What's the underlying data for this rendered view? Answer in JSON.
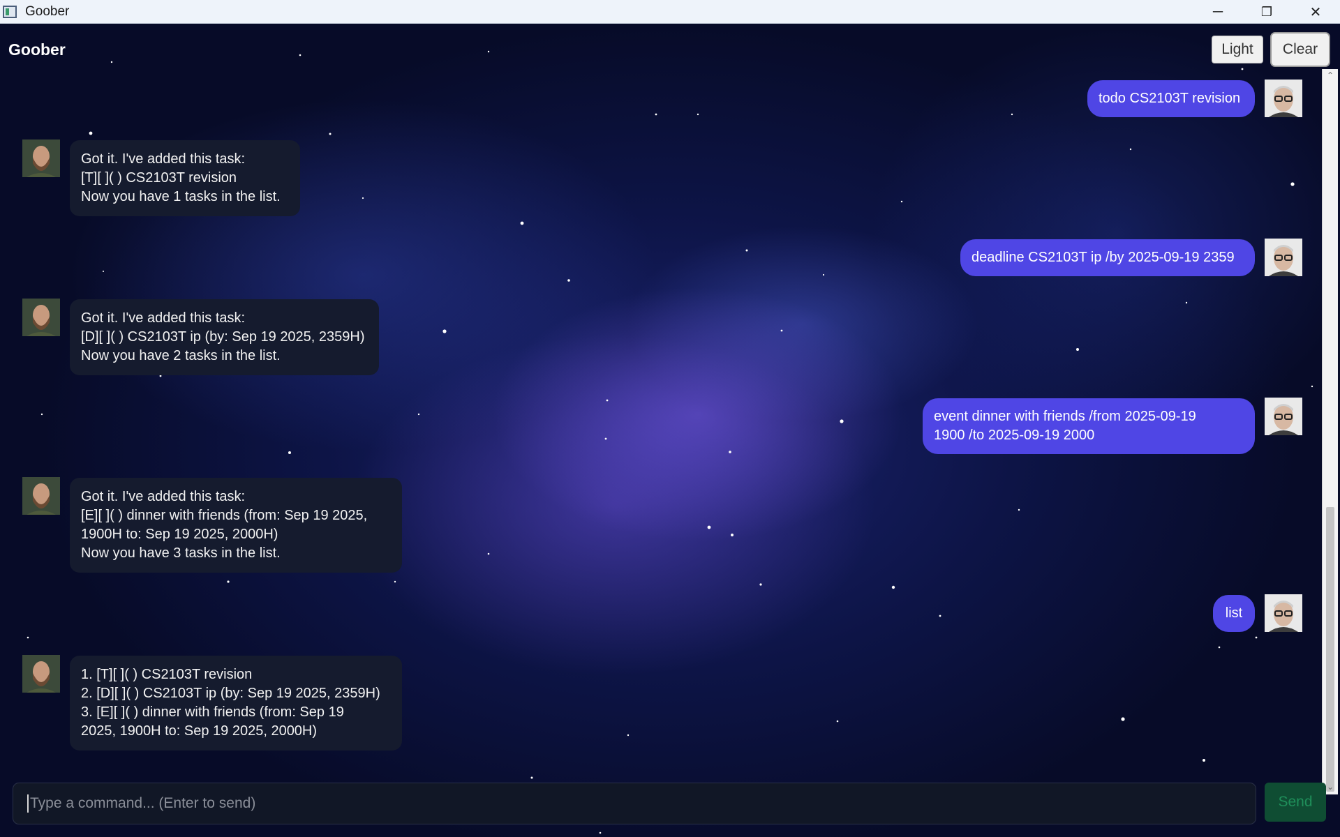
{
  "window": {
    "title": "Goober",
    "controls": {
      "minimize": "─",
      "restore": "❐",
      "close": "✕"
    }
  },
  "header": {
    "app_name": "Goober",
    "light_label": "Light",
    "clear_label": "Clear"
  },
  "messages": {
    "user": [
      {
        "lines": [
          "todo CS2103T revision"
        ]
      },
      {
        "lines": [
          "deadline CS2103T ip /by 2025-09-19 2359"
        ]
      },
      {
        "lines": [
          "event dinner with friends /from 2025-09-19",
          "1900 /to 2025-09-19 2000"
        ]
      },
      {
        "lines": [
          "list"
        ]
      }
    ],
    "bot": [
      {
        "lines": [
          "Got it. I've added this task:",
          "[T][ ]( ) CS2103T revision",
          "Now you have 1 tasks in the list."
        ]
      },
      {
        "lines": [
          "Got it. I've added this task:",
          "[D][ ]( ) CS2103T ip (by: Sep 19 2025, 2359H)",
          "Now you have 2 tasks in the list."
        ]
      },
      {
        "lines": [
          "Got it. I've added this task:",
          "[E][ ]( ) dinner with friends (from: Sep 19 2025,",
          "1900H to: Sep 19 2025, 2000H)",
          "Now you have 3 tasks in the list."
        ]
      },
      {
        "lines": [
          "1. [T][ ]( ) CS2103T revision",
          "2. [D][ ]( ) CS2103T ip (by: Sep 19 2025, 2359H)",
          "3. [E][ ]( ) dinner with friends (from: Sep 19",
          "2025, 1900H to: Sep 19 2025, 2000H)"
        ]
      }
    ]
  },
  "input": {
    "placeholder": "Type a command... (Enter to send)",
    "value": "",
    "send_label": "Send"
  },
  "colors": {
    "user_bubble": "#4f46e5",
    "bot_bubble": "#151b2e",
    "send_button": "#0f4d33"
  }
}
